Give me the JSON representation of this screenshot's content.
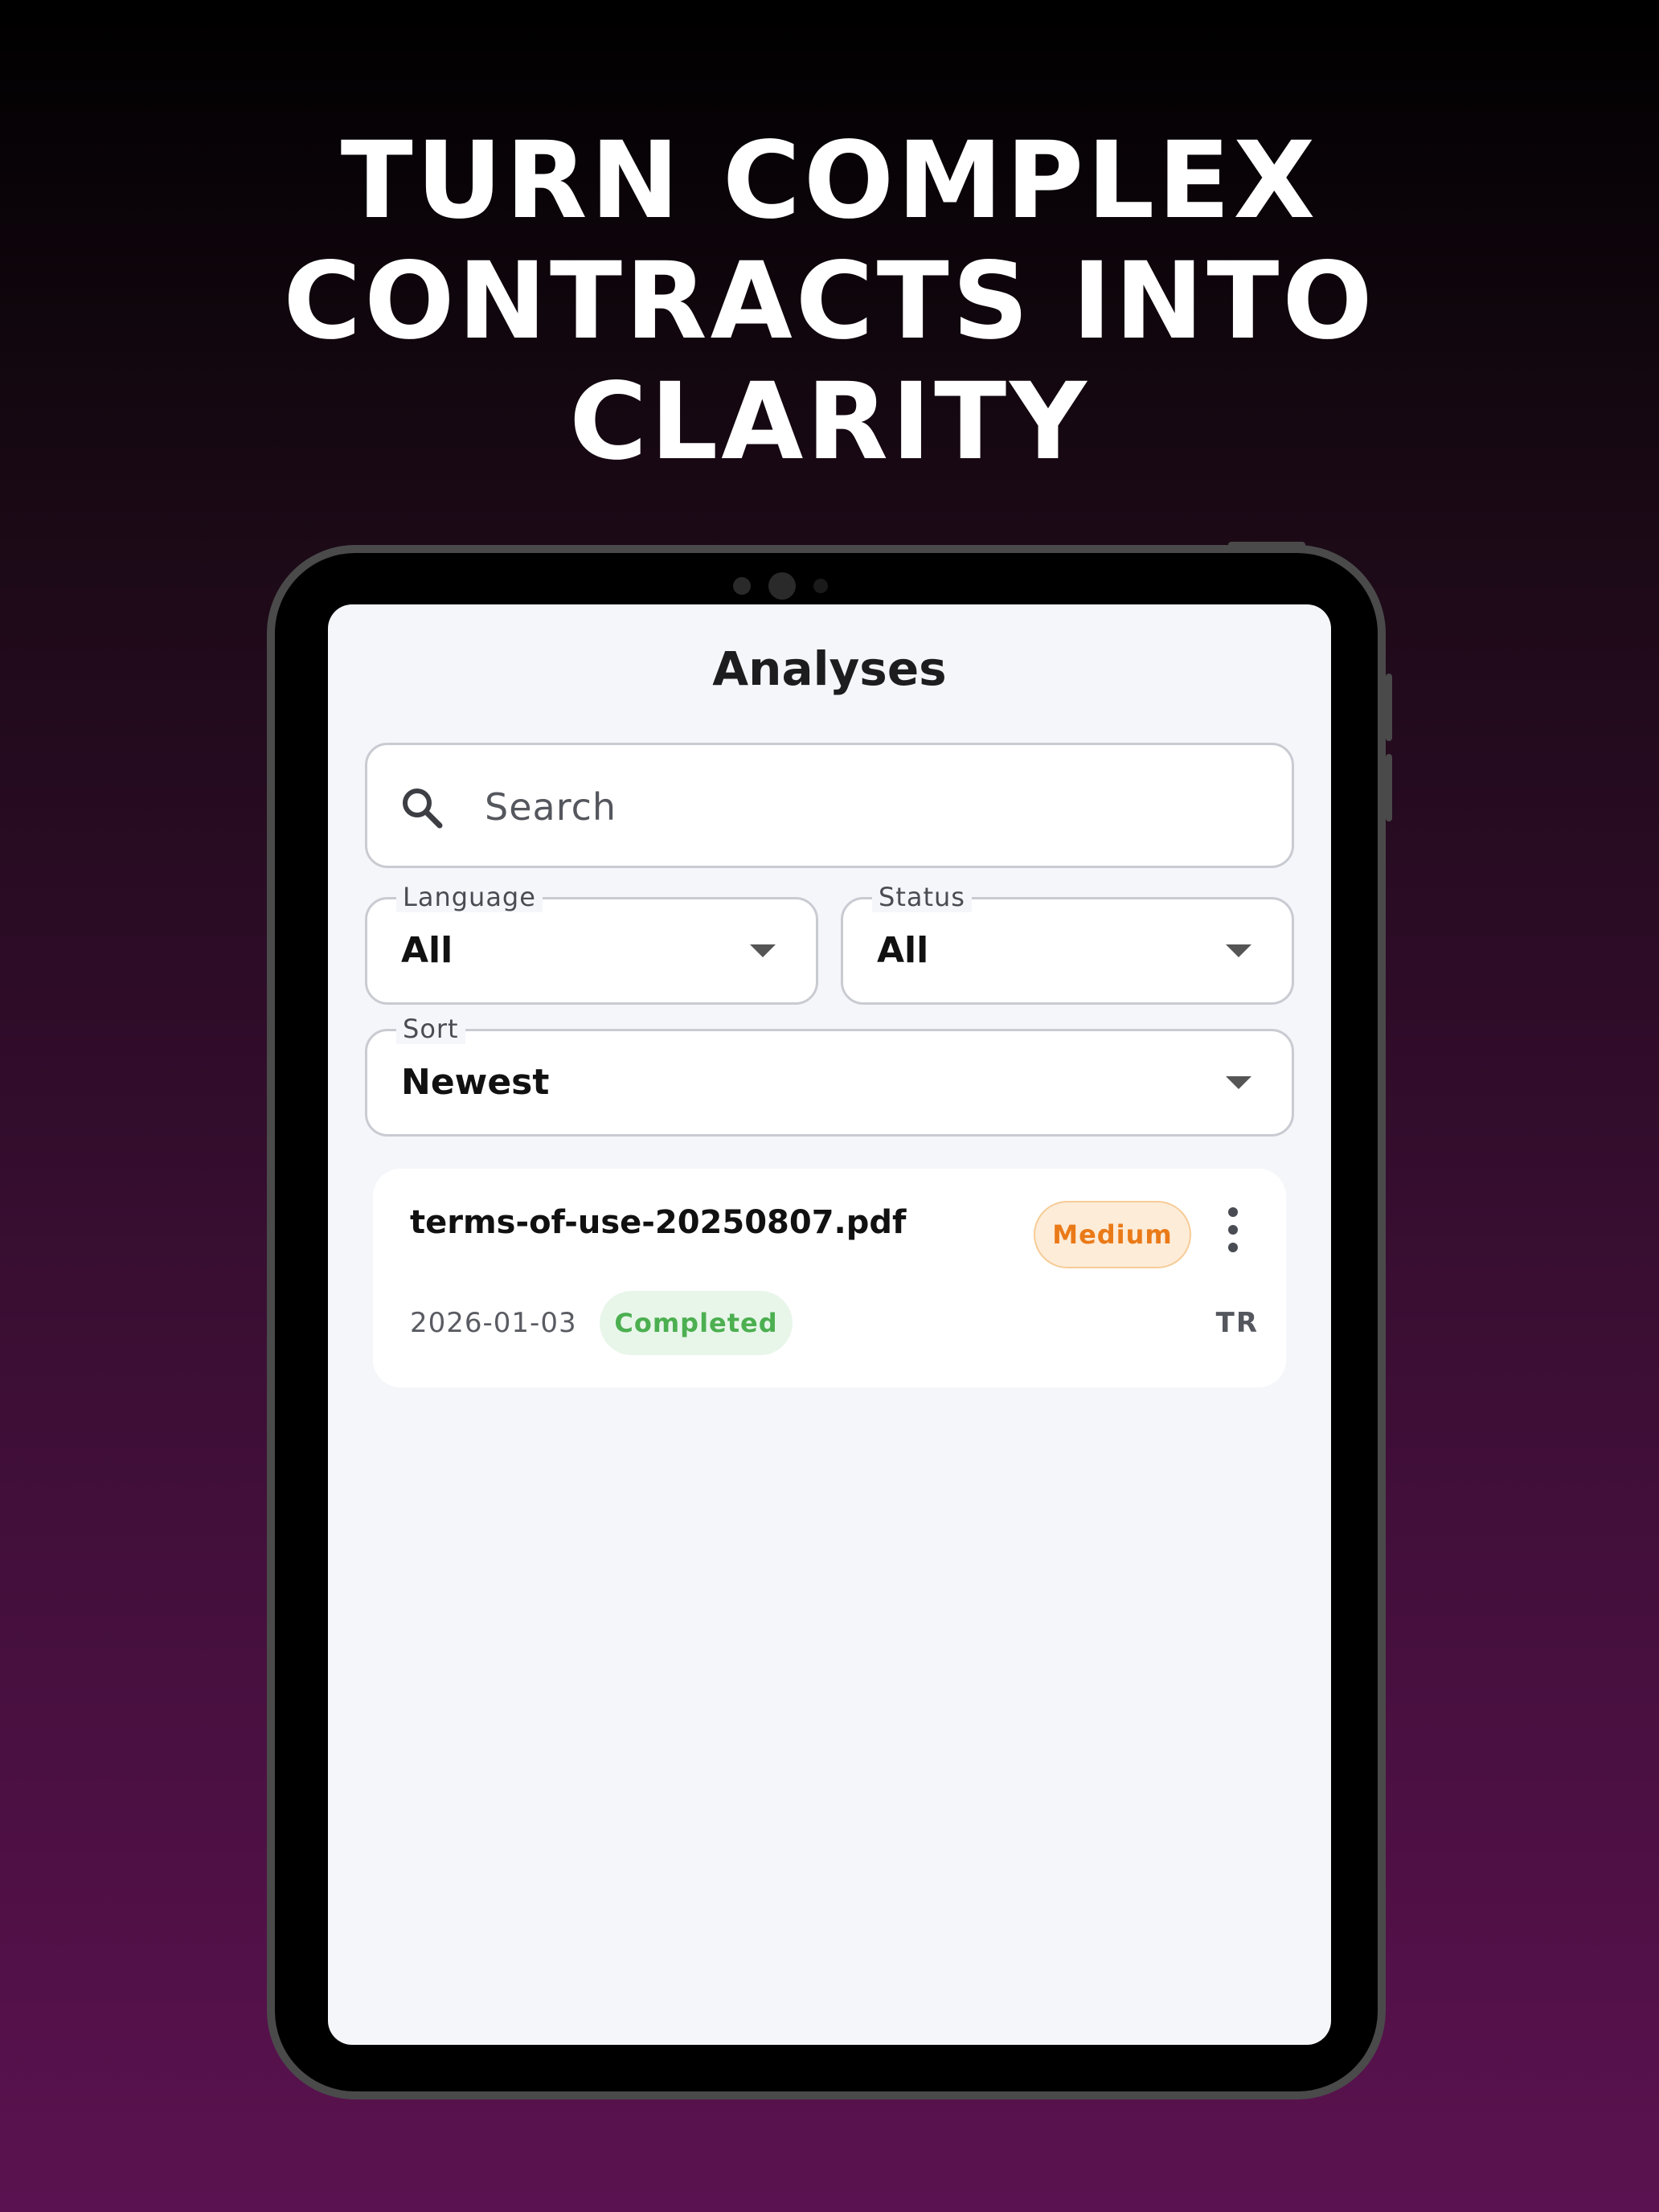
{
  "headline": {
    "lines": [
      "TURN COMPLEX",
      "CONTRACTS INTO",
      "CLARITY"
    ]
  },
  "screen": {
    "title": "Analyses",
    "search": {
      "placeholder": "Search",
      "icon": "search-icon"
    },
    "filters": {
      "language": {
        "label": "Language",
        "value": "All"
      },
      "status": {
        "label": "Status",
        "value": "All"
      },
      "sort": {
        "label": "Sort",
        "value": "Newest"
      }
    },
    "analyses": [
      {
        "file_name": "terms-of-use-20250807.pdf",
        "risk": "Medium",
        "date": "2026-01-03",
        "status": "Completed",
        "language": "TR"
      }
    ]
  },
  "colors": {
    "risk_medium_text": "#ea7a18",
    "risk_medium_bg": "#fdecd8",
    "status_completed_text": "#4caf50",
    "status_completed_bg": "#e8f6ea",
    "background_top": "#000000",
    "background_bottom": "#5b1250"
  }
}
